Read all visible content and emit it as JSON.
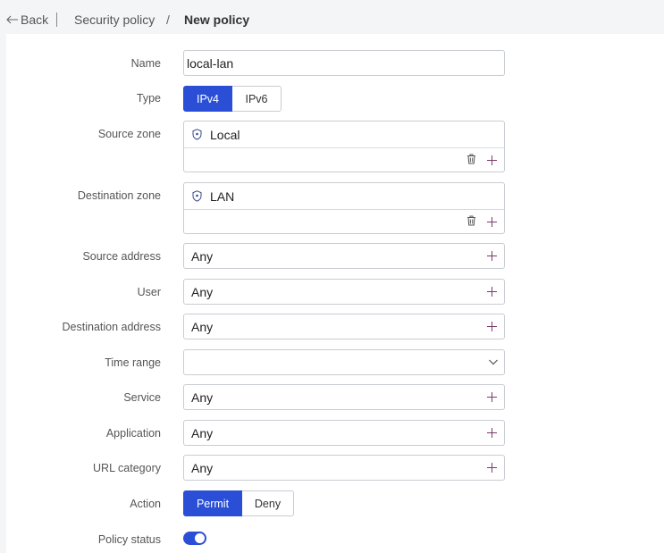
{
  "breadcrumb": {
    "back_label": "Back",
    "parent_label": "Security policy",
    "separator": "/",
    "current_label": "New policy"
  },
  "form": {
    "name": {
      "label": "Name",
      "value": "local-lan"
    },
    "type": {
      "label": "Type",
      "options": [
        "IPv4",
        "IPv6"
      ],
      "selected": "IPv4"
    },
    "source_zone": {
      "label": "Source zone",
      "value": "Local"
    },
    "destination_zone": {
      "label": "Destination zone",
      "value": "LAN"
    },
    "source_address": {
      "label": "Source address",
      "value": "Any"
    },
    "user": {
      "label": "User",
      "value": "Any"
    },
    "destination_address": {
      "label": "Destination address",
      "value": "Any"
    },
    "time_range": {
      "label": "Time range",
      "value": ""
    },
    "service": {
      "label": "Service",
      "value": "Any"
    },
    "application": {
      "label": "Application",
      "value": "Any"
    },
    "url_category": {
      "label": "URL category",
      "value": "Any"
    },
    "action": {
      "label": "Action",
      "options": [
        "Permit",
        "Deny"
      ],
      "selected": "Permit"
    },
    "policy_status": {
      "label": "Policy status",
      "enabled": true
    }
  },
  "colors": {
    "accent": "#2a4fd6",
    "plus_icon": "#7a3a6a",
    "border": "#c9ccd1"
  }
}
